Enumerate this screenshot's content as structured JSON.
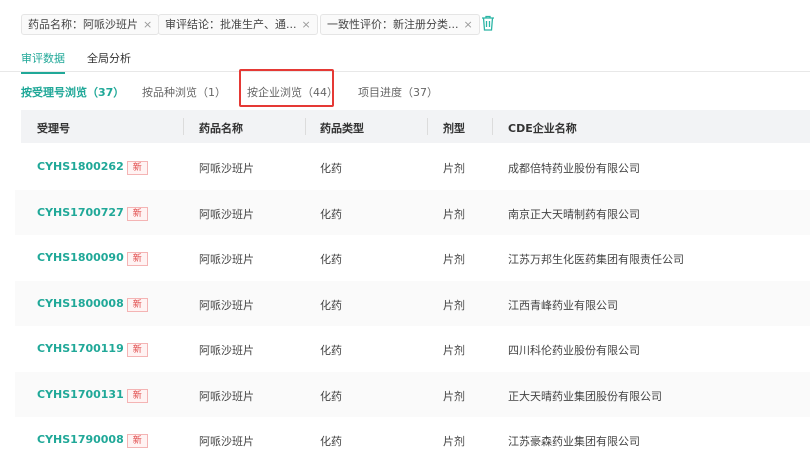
{
  "filters": [
    {
      "label": "药品名称：阿哌沙班片"
    },
    {
      "label": "审评结论：批准生产、通..."
    },
    {
      "label": "一致性评价：新注册分类..."
    }
  ],
  "close_glyph": "×",
  "tabs": [
    {
      "label": "审评数据"
    },
    {
      "label": "全局分析"
    }
  ],
  "subtabs": [
    {
      "label": "按受理号浏览（37）"
    },
    {
      "label": "按品种浏览（1）"
    },
    {
      "label": "按企业浏览（44）"
    },
    {
      "label": "项目进度（37）"
    }
  ],
  "columns": [
    "受理号",
    "药品名称",
    "药品类型",
    "剂型",
    "CDE企业名称"
  ],
  "badge": "新",
  "rows": [
    {
      "id": "CYHS1800262",
      "name": "阿哌沙班片",
      "type": "化药",
      "form": "片剂",
      "company": "成都倍特药业股份有限公司"
    },
    {
      "id": "CYHS1700727",
      "name": "阿哌沙班片",
      "type": "化药",
      "form": "片剂",
      "company": "南京正大天晴制药有限公司"
    },
    {
      "id": "CYHS1800090",
      "name": "阿哌沙班片",
      "type": "化药",
      "form": "片剂",
      "company": "江苏万邦生化医药集团有限责任公司"
    },
    {
      "id": "CYHS1800008",
      "name": "阿哌沙班片",
      "type": "化药",
      "form": "片剂",
      "company": "江西青峰药业有限公司"
    },
    {
      "id": "CYHS1700119",
      "name": "阿哌沙班片",
      "type": "化药",
      "form": "片剂",
      "company": "四川科伦药业股份有限公司"
    },
    {
      "id": "CYHS1700131",
      "name": "阿哌沙班片",
      "type": "化药",
      "form": "片剂",
      "company": "正大天晴药业集团股份有限公司"
    },
    {
      "id": "CYHS1790008",
      "name": "阿哌沙班片",
      "type": "化药",
      "form": "片剂",
      "company": "江苏豪森药业集团有限公司"
    }
  ]
}
